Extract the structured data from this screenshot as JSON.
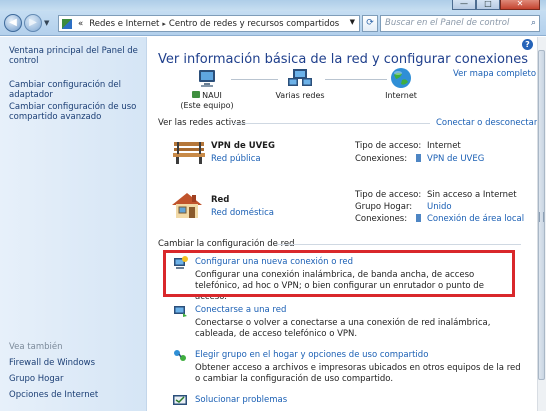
{
  "window": {
    "minimize": "—",
    "maximize": "□",
    "close": "✕"
  },
  "address": {
    "back_icon": "back-arrow-icon",
    "forward_icon": "forward-arrow-icon",
    "overflow": "«",
    "crumb1": "Redes e Internet",
    "crumb2": "Centro de redes y recursos compartidos",
    "search_placeholder": "Buscar en el Panel de control"
  },
  "sidebar": {
    "links": [
      "Ventana principal del Panel de control",
      "Cambiar configuración del adaptador",
      "Cambiar configuración de uso compartido avanzado"
    ],
    "see_also_title": "Vea también",
    "see_also": [
      "Firewall de Windows",
      "Grupo Hogar",
      "Opciones de Internet"
    ]
  },
  "main": {
    "title": "Ver información básica de la red y configurar conexiones",
    "full_map": "Ver mapa completo",
    "map": {
      "computer": "NAUI",
      "computer_sub": "(Este equipo)",
      "middle": "Varias redes",
      "internet": "Internet"
    },
    "active_title": "Ver las redes activas",
    "connect_link": "Conectar o desconectar",
    "networks": [
      {
        "name": "VPN de UVEG",
        "type": "Red pública",
        "access_label": "Tipo de acceso:",
        "access_value": "Internet",
        "conn_label": "Conexiones:",
        "conn_value": "VPN de UVEG"
      },
      {
        "name": "Red",
        "type": "Red doméstica",
        "access_label": "Tipo de acceso:",
        "access_value": "Sin acceso a Internet",
        "home_label": "Grupo Hogar:",
        "home_value": "Unido",
        "conn_label": "Conexiones:",
        "conn_value": "Conexión de área local"
      }
    ],
    "change_title": "Cambiar la configuración de red",
    "tasks": [
      {
        "title": "Configurar una nueva conexión o red",
        "desc": "Configurar una conexión inalámbrica, de banda ancha, de acceso telefónico, ad hoc o VPN; o bien configurar un enrutador o punto de acceso."
      },
      {
        "title": "Conectarse a una red",
        "desc": "Conectarse o volver a conectarse a una conexión de red inalámbrica, cableada, de acceso telefónico o VPN."
      },
      {
        "title": "Elegir grupo en el hogar y opciones de uso compartido",
        "desc": "Obtener acceso a archivos e impresoras ubicados en otros equipos de la red o cambiar la configuración de uso compartido."
      },
      {
        "title": "Solucionar problemas",
        "desc": ""
      }
    ]
  },
  "colors": {
    "link": "#1a5fb4",
    "heading": "#1f3f8c",
    "highlight": "#d9282b",
    "sidebar_bg": "#dbe8f6"
  }
}
